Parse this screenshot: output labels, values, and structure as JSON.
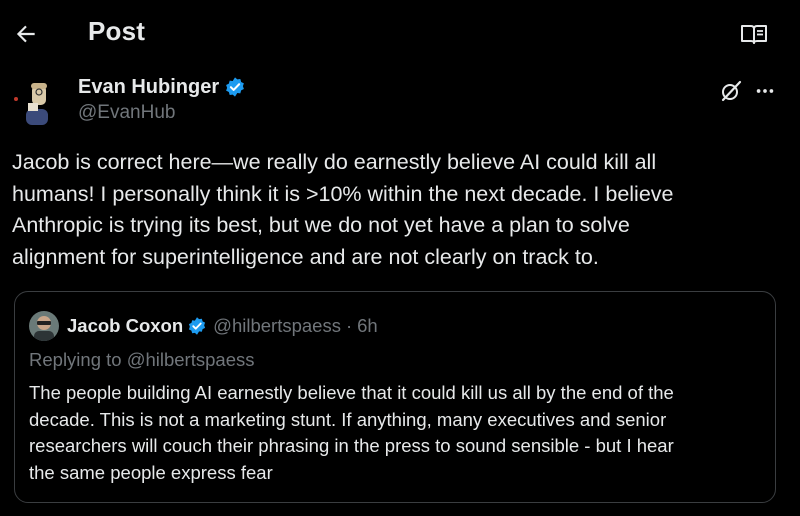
{
  "header": {
    "title": "Post",
    "back_icon": "arrow-left-icon",
    "reader_icon": "reader-book-icon"
  },
  "post": {
    "author": {
      "name": "Evan Hubinger",
      "handle": "@EvanHub",
      "verified": true
    },
    "actions": {
      "grok_icon": "grok-icon",
      "more_icon": "more-dots-icon"
    },
    "text": "Jacob is correct here—we really do earnestly believe AI could kill all\nhumans! I personally think it is >10% within the next decade. I believe\nAnthropic is trying its best, but we do not yet have a plan to solve\nalignment for superintelligence and are not clearly on track to."
  },
  "quote": {
    "author": {
      "name": "Jacob Coxon",
      "handle": "@hilbertspaess",
      "verified": true
    },
    "separator": "·",
    "time": "6h",
    "replying_to": "Replying to @hilbertspaess",
    "text": "The people building AI earnestly believe that it could kill us all by the end of the\ndecade. This is not a marketing stunt. If anything, many executives and senior\nresearchers will couch their phrasing in the press to sound sensible - but I hear\nthe same people express fear"
  },
  "colors": {
    "background": "#000000",
    "text_primary": "#e7e9ea",
    "text_secondary": "#71767b",
    "verified_blue": "#1d9bf0",
    "border": "#3a3d40"
  }
}
